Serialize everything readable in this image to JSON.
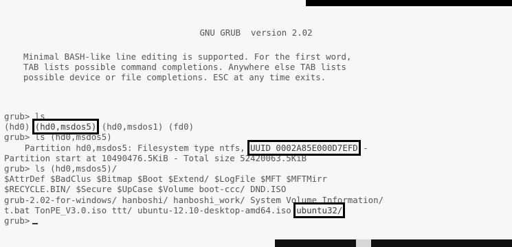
{
  "header": {
    "title": "GNU GRUB  version 2.02"
  },
  "intro": {
    "line1": "Minimal BASH-like line editing is supported. For the first word,",
    "line2": "TAB lists possible command completions. Anywhere else TAB lists",
    "line3": "possible device or file completions. ESC at any time exits."
  },
  "console": {
    "cmd1": "grub> ls",
    "devices_pre": "(hd0) ",
    "devices_highlight": "(hd0,msdos5)",
    "devices_post": " (hd0,msdos1) (fd0)",
    "cmd2": "grub> ls (hd0,msdos5)",
    "partition_info": "    Partition hd0,msdos5: Filesystem type ntfs, ",
    "uuid": "UUID 0002A85E000D7EFD",
    "uuid_tail": " -",
    "partition_start": "Partition start at 10490476.5KiB - Total size 52420063.5KiB",
    "cmd3": "grub> ls (hd0,msdos5)/",
    "files_line1": "$AttrDef $BadClus $Bitmap $Boot $Extend/ $LogFile $MFT $MFTMirr",
    "files_line2": "$RECYCLE.BIN/ $Secure $UpCase $Volume boot-ccc/ DND.ISO",
    "files_line3": "grub-2.02-for-windows/ hanboshi/ hanboshi_work/ System Volume Information/",
    "files_line4_pre": "t.bat TonPE_V3.0.iso ttt/ ubuntu-12.10-desktop-amd64.iso ",
    "files_line4_highlight": "ubuntu32/",
    "prompt": "grub>"
  }
}
